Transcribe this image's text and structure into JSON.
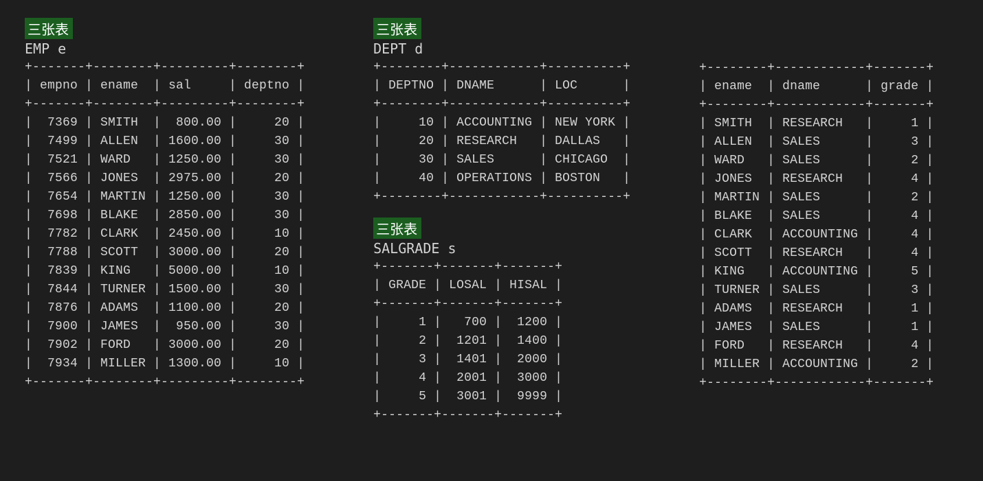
{
  "badge_text": "三张表",
  "emp": {
    "title": "EMP e",
    "columns": [
      "empno",
      "ename",
      "sal",
      "deptno"
    ],
    "rows": [
      {
        "empno": 7369,
        "ename": "SMITH",
        "sal": "800.00",
        "deptno": 20
      },
      {
        "empno": 7499,
        "ename": "ALLEN",
        "sal": "1600.00",
        "deptno": 30
      },
      {
        "empno": 7521,
        "ename": "WARD",
        "sal": "1250.00",
        "deptno": 30
      },
      {
        "empno": 7566,
        "ename": "JONES",
        "sal": "2975.00",
        "deptno": 20
      },
      {
        "empno": 7654,
        "ename": "MARTIN",
        "sal": "1250.00",
        "deptno": 30
      },
      {
        "empno": 7698,
        "ename": "BLAKE",
        "sal": "2850.00",
        "deptno": 30
      },
      {
        "empno": 7782,
        "ename": "CLARK",
        "sal": "2450.00",
        "deptno": 10
      },
      {
        "empno": 7788,
        "ename": "SCOTT",
        "sal": "3000.00",
        "deptno": 20
      },
      {
        "empno": 7839,
        "ename": "KING",
        "sal": "5000.00",
        "deptno": 10
      },
      {
        "empno": 7844,
        "ename": "TURNER",
        "sal": "1500.00",
        "deptno": 30
      },
      {
        "empno": 7876,
        "ename": "ADAMS",
        "sal": "1100.00",
        "deptno": 20
      },
      {
        "empno": 7900,
        "ename": "JAMES",
        "sal": "950.00",
        "deptno": 30
      },
      {
        "empno": 7902,
        "ename": "FORD",
        "sal": "3000.00",
        "deptno": 20
      },
      {
        "empno": 7934,
        "ename": "MILLER",
        "sal": "1300.00",
        "deptno": 10
      }
    ]
  },
  "dept": {
    "title": "DEPT d",
    "columns": [
      "DEPTNO",
      "DNAME",
      "LOC"
    ],
    "rows": [
      {
        "DEPTNO": 10,
        "DNAME": "ACCOUNTING",
        "LOC": "NEW YORK"
      },
      {
        "DEPTNO": 20,
        "DNAME": "RESEARCH",
        "LOC": "DALLAS"
      },
      {
        "DEPTNO": 30,
        "DNAME": "SALES",
        "LOC": "CHICAGO"
      },
      {
        "DEPTNO": 40,
        "DNAME": "OPERATIONS",
        "LOC": "BOSTON"
      }
    ]
  },
  "salgrade": {
    "title": "SALGRADE s",
    "columns": [
      "GRADE",
      "LOSAL",
      "HISAL"
    ],
    "rows": [
      {
        "GRADE": 1,
        "LOSAL": 700,
        "HISAL": 1200
      },
      {
        "GRADE": 2,
        "LOSAL": 1201,
        "HISAL": 1400
      },
      {
        "GRADE": 3,
        "LOSAL": 1401,
        "HISAL": 2000
      },
      {
        "GRADE": 4,
        "LOSAL": 2001,
        "HISAL": 3000
      },
      {
        "GRADE": 5,
        "LOSAL": 3001,
        "HISAL": 9999
      }
    ]
  },
  "result": {
    "columns": [
      "ename",
      "dname",
      "grade"
    ],
    "rows": [
      {
        "ename": "SMITH",
        "dname": "RESEARCH",
        "grade": 1
      },
      {
        "ename": "ALLEN",
        "dname": "SALES",
        "grade": 3
      },
      {
        "ename": "WARD",
        "dname": "SALES",
        "grade": 2
      },
      {
        "ename": "JONES",
        "dname": "RESEARCH",
        "grade": 4
      },
      {
        "ename": "MARTIN",
        "dname": "SALES",
        "grade": 2
      },
      {
        "ename": "BLAKE",
        "dname": "SALES",
        "grade": 4
      },
      {
        "ename": "CLARK",
        "dname": "ACCOUNTING",
        "grade": 4
      },
      {
        "ename": "SCOTT",
        "dname": "RESEARCH",
        "grade": 4
      },
      {
        "ename": "KING",
        "dname": "ACCOUNTING",
        "grade": 5
      },
      {
        "ename": "TURNER",
        "dname": "SALES",
        "grade": 3
      },
      {
        "ename": "ADAMS",
        "dname": "RESEARCH",
        "grade": 1
      },
      {
        "ename": "JAMES",
        "dname": "SALES",
        "grade": 1
      },
      {
        "ename": "FORD",
        "dname": "RESEARCH",
        "grade": 4
      },
      {
        "ename": "MILLER",
        "dname": "ACCOUNTING",
        "grade": 2
      }
    ]
  }
}
